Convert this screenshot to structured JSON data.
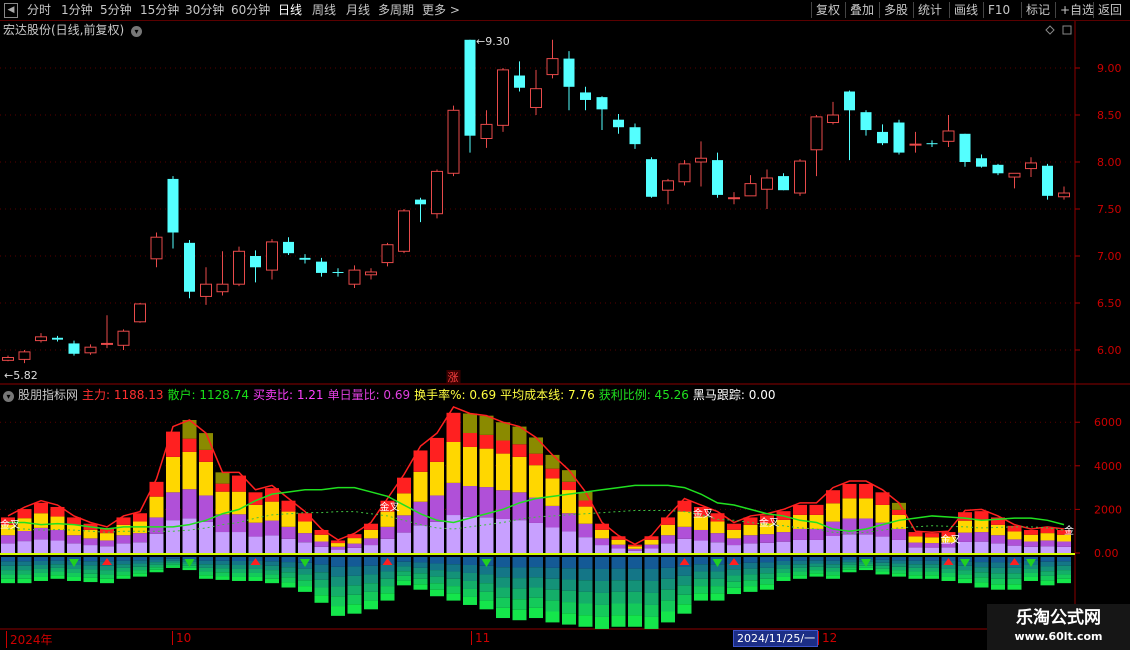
{
  "toolbar": {
    "periods": [
      "分时",
      "1分钟",
      "5分钟",
      "15分钟",
      "30分钟",
      "60分钟",
      "日线",
      "周线",
      "月线",
      "多周期",
      "更多 >"
    ],
    "active_period": "日线",
    "right_buttons": [
      "复权",
      "叠加",
      "多股",
      "统计",
      "画线",
      "F10",
      "标记",
      "+自选",
      "返回"
    ]
  },
  "price_panel": {
    "title": "宏达股份(日线,前复权)",
    "max_label": "9.30",
    "min_label": "5.82",
    "axis_ticks": [
      "9.00",
      "8.50",
      "8.00",
      "7.50",
      "7.00",
      "6.50",
      "6.00"
    ],
    "axis_values": [
      9.0,
      8.5,
      8.0,
      7.5,
      7.0,
      6.5,
      6.0
    ],
    "up_color": "#e84a4a",
    "down_color": "#54ffff",
    "candles": [
      [
        5.89,
        5.92,
        5.88,
        5.94
      ],
      [
        5.9,
        5.98,
        5.86,
        6.0
      ],
      [
        6.1,
        6.14,
        6.08,
        6.18
      ],
      [
        6.13,
        6.11,
        6.09,
        6.15
      ],
      [
        6.07,
        5.96,
        5.94,
        6.1
      ],
      [
        5.97,
        6.03,
        5.95,
        6.06
      ],
      [
        6.06,
        6.07,
        6.02,
        6.37
      ],
      [
        6.05,
        6.2,
        6.0,
        6.22
      ],
      [
        6.3,
        6.49,
        6.29,
        6.5
      ],
      [
        6.97,
        7.2,
        6.88,
        7.25
      ],
      [
        7.82,
        7.25,
        7.08,
        7.85
      ],
      [
        7.14,
        6.62,
        6.55,
        7.17
      ],
      [
        6.57,
        6.7,
        6.48,
        6.88
      ],
      [
        6.62,
        6.7,
        6.58,
        7.05
      ],
      [
        6.7,
        7.05,
        6.68,
        7.1
      ],
      [
        7.0,
        6.88,
        6.72,
        7.06
      ],
      [
        6.85,
        7.15,
        6.75,
        7.18
      ],
      [
        7.15,
        7.03,
        7.01,
        7.2
      ],
      [
        6.98,
        6.96,
        6.92,
        7.02
      ],
      [
        6.94,
        6.82,
        6.78,
        6.98
      ],
      [
        6.83,
        6.82,
        6.78,
        6.87
      ],
      [
        6.7,
        6.85,
        6.66,
        6.9
      ],
      [
        6.8,
        6.83,
        6.75,
        6.87
      ],
      [
        6.93,
        7.12,
        6.89,
        7.14
      ],
      [
        7.05,
        7.48,
        7.03,
        7.5
      ],
      [
        7.6,
        7.55,
        7.36,
        7.62
      ],
      [
        7.45,
        7.9,
        7.4,
        7.92
      ],
      [
        7.88,
        8.55,
        7.85,
        8.6
      ],
      [
        9.3,
        8.28,
        8.1,
        9.3
      ],
      [
        8.25,
        8.4,
        8.15,
        8.55
      ],
      [
        8.39,
        8.98,
        8.32,
        9.0
      ],
      [
        8.92,
        8.79,
        8.75,
        9.07
      ],
      [
        8.58,
        8.78,
        8.5,
        8.98
      ],
      [
        8.93,
        9.1,
        8.89,
        9.3
      ],
      [
        9.1,
        8.8,
        8.55,
        9.18
      ],
      [
        8.74,
        8.66,
        8.55,
        8.8
      ],
      [
        8.69,
        8.56,
        8.34,
        8.7
      ],
      [
        8.45,
        8.37,
        8.3,
        8.51
      ],
      [
        8.37,
        8.19,
        8.14,
        8.41
      ],
      [
        8.03,
        7.63,
        7.62,
        8.05
      ],
      [
        7.7,
        7.8,
        7.55,
        7.82
      ],
      [
        7.79,
        7.98,
        7.75,
        8.02
      ],
      [
        8.0,
        8.04,
        7.74,
        8.22
      ],
      [
        8.02,
        7.65,
        7.62,
        8.1
      ],
      [
        7.61,
        7.62,
        7.55,
        7.68
      ],
      [
        7.64,
        7.77,
        7.64,
        7.86
      ],
      [
        7.71,
        7.83,
        7.5,
        7.92
      ],
      [
        7.85,
        7.7,
        7.7,
        7.88
      ],
      [
        7.67,
        8.01,
        7.64,
        8.03
      ],
      [
        8.13,
        8.48,
        7.85,
        8.5
      ],
      [
        8.42,
        8.5,
        8.4,
        8.64
      ],
      [
        8.75,
        8.55,
        8.02,
        8.76
      ],
      [
        8.53,
        8.34,
        8.28,
        8.55
      ],
      [
        8.32,
        8.2,
        8.18,
        8.4
      ],
      [
        8.42,
        8.1,
        8.08,
        8.45
      ],
      [
        8.18,
        8.19,
        8.1,
        8.32
      ],
      [
        8.2,
        8.19,
        8.16,
        8.23
      ],
      [
        8.22,
        8.33,
        8.16,
        8.5
      ],
      [
        8.3,
        8.0,
        7.95,
        8.3
      ],
      [
        8.04,
        7.95,
        7.94,
        8.08
      ],
      [
        7.97,
        7.88,
        7.86,
        7.98
      ],
      [
        7.84,
        7.88,
        7.72,
        7.88
      ],
      [
        7.93,
        7.99,
        7.84,
        8.05
      ],
      [
        7.96,
        7.64,
        7.6,
        7.98
      ],
      [
        7.63,
        7.67,
        7.6,
        7.74
      ]
    ]
  },
  "indicator_panel": {
    "name": "股朋指标网",
    "fields": [
      {
        "label": "主力:",
        "value": "1188.13",
        "color": "#ff3030"
      },
      {
        "label": "散户:",
        "value": "1128.74",
        "color": "#18e018"
      },
      {
        "label": "买卖比:",
        "value": "1.21",
        "color": "#ff40ff"
      },
      {
        "label": "单日量比:",
        "value": "0.69",
        "color": "#e040e0"
      },
      {
        "label": "换手率%:",
        "value": "0.69",
        "color": "#ffff40"
      },
      {
        "label": "平均成本线:",
        "value": "7.76",
        "color": "#ffff40"
      },
      {
        "label": "获利比例:",
        "value": "45.26",
        "color": "#20e020"
      },
      {
        "label": "黑马跟踪:",
        "value": "0.00",
        "color": "#ffffff"
      }
    ],
    "zhang_label": "涨",
    "jincha_label": "金叉",
    "jin_label": "金",
    "axis_ticks": [
      "6000",
      "4000",
      "2000",
      "0.00"
    ],
    "axis_values": [
      6000,
      4000,
      2000,
      0
    ],
    "bar_totals": [
      1700,
      2100,
      2400,
      2200,
      1700,
      1400,
      1200,
      1700,
      1900,
      3400,
      5800,
      6100,
      5500,
      3700,
      3700,
      2900,
      3100,
      2500,
      1900,
      1100,
      600,
      900,
      1400,
      2500,
      3600,
      4900,
      5500,
      6700,
      6400,
      6300,
      6000,
      5800,
      5300,
      4500,
      3800,
      2800,
      1400,
      800,
      400,
      800,
      1700,
      2500,
      2200,
      1900,
      1400,
      1700,
      1800,
      2000,
      2300,
      2300,
      3000,
      3300,
      3300,
      2900,
      2300,
      1000,
      950,
      1000,
      1950,
      2000,
      1700,
      1300,
      1100,
      1200,
      1100
    ],
    "neg_values": [
      -1200,
      -1200,
      -1100,
      -1000,
      -1100,
      -1150,
      -1200,
      -1000,
      -900,
      -700,
      -500,
      -600,
      -1000,
      -1050,
      -1100,
      -1100,
      -1200,
      -1400,
      -1600,
      -2100,
      -2700,
      -2600,
      -2400,
      -2000,
      -1300,
      -1500,
      -1800,
      -2000,
      -2200,
      -2400,
      -2800,
      -2900,
      -2800,
      -3000,
      -3100,
      -3200,
      -3300,
      -3200,
      -3200,
      -3300,
      -3000,
      -2600,
      -2000,
      -2000,
      -1700,
      -1600,
      -1500,
      -1100,
      -1000,
      -900,
      -1000,
      -700,
      -600,
      -800,
      -900,
      -1000,
      -1000,
      -1100,
      -1200,
      -1400,
      -1500,
      -1500,
      -1100,
      -1300,
      -1200
    ],
    "green_line": [
      1400,
      1400,
      1300,
      1350,
      1300,
      1200,
      1100,
      1200,
      1200,
      1200,
      1200,
      1300,
      1500,
      1800,
      2000,
      2400,
      2700,
      2800,
      2900,
      2900,
      3000,
      3000,
      2800,
      2600,
      2200,
      1800,
      1500,
      1400,
      1600,
      1800,
      2000,
      2300,
      2500,
      2600,
      2700,
      2800,
      2900,
      3000,
      3100,
      3100,
      3100,
      3000,
      2700,
      2300,
      2200,
      2000,
      1800,
      1700,
      1500,
      1400,
      1100,
      1000,
      1100,
      1300,
      1500,
      1600,
      1700,
      1650,
      1600,
      1500,
      1550,
      1600,
      1600,
      1500,
      1300
    ],
    "up_arrows": [
      6,
      15,
      23,
      41,
      44,
      57,
      61
    ],
    "down_arrows": [
      4,
      11,
      18,
      29,
      43,
      52,
      58,
      62
    ],
    "jincha_positions": [
      0,
      23,
      42,
      46,
      57
    ],
    "zhang_index": 27
  },
  "date_axis": {
    "labels": [
      {
        "text": "2024年",
        "index": 0
      },
      {
        "text": "10",
        "index": 10
      },
      {
        "text": "11",
        "index": 28
      },
      {
        "text": "12",
        "index": 48
      }
    ],
    "highlight": "2024/11/25/一"
  },
  "watermark": {
    "title": "乐淘公式网",
    "url": "www.60lt.com"
  }
}
